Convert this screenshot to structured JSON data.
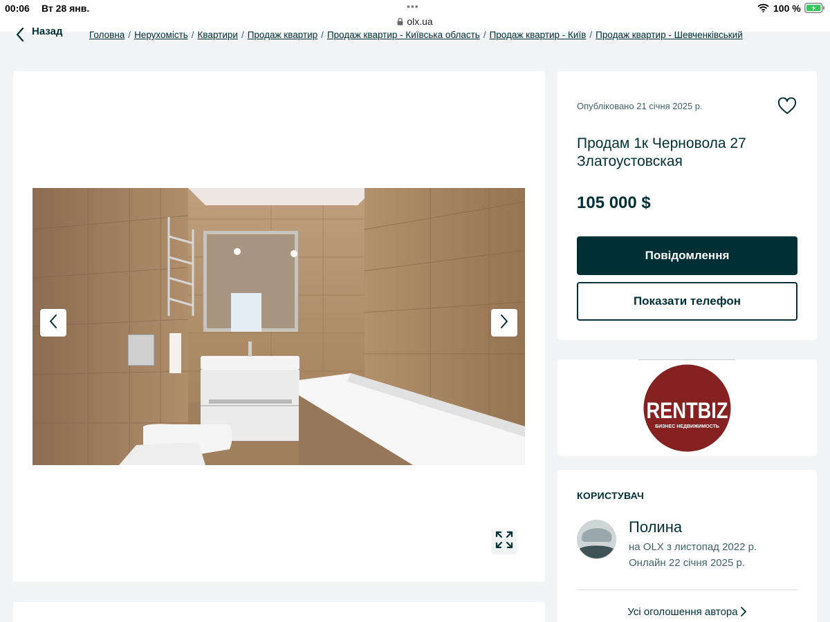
{
  "status_bar": {
    "time": "00:06",
    "date": "Вт 28 янв.",
    "url": "olx.ua",
    "battery": "100 %"
  },
  "nav": {
    "back_label": "Назад",
    "breadcrumb": [
      "Головна",
      "Нерухомість",
      "Квартири",
      "Продаж квартир",
      "Продаж квартир - Київська область",
      "Продаж квартир - Київ",
      "Продаж квартир - Шевченківський"
    ],
    "separator": "/"
  },
  "listing": {
    "published": "Опубліковано 21 січня 2025 р.",
    "title": "Продам 1к Черновола 27 Златоустовская",
    "price": "105 000 $",
    "message_button": "Повідомлення",
    "phone_button": "Показати телефон"
  },
  "seller_logo": {
    "brand": "RENTBIZ",
    "tagline": "БИЗНЕС НЕДВИЖИМОСТЬ",
    "color": "#7a1c1c"
  },
  "user": {
    "heading": "КОРИСТУВАЧ",
    "name": "Полина",
    "member_since": "на OLX з листопад 2022 р.",
    "online": "Онлайн 22 січня 2025 р.",
    "all_ads_link": "Усі оголошення автора"
  },
  "colors": {
    "primary": "#002f34",
    "background": "#f2f4f5",
    "battery": "#34c759"
  },
  "icons": {
    "back": "chevron-left-icon",
    "prev": "chevron-left-icon",
    "next": "chevron-right-icon",
    "fullscreen": "expand-icon",
    "favorite": "heart-icon",
    "all_ads": "chevron-right-icon"
  }
}
